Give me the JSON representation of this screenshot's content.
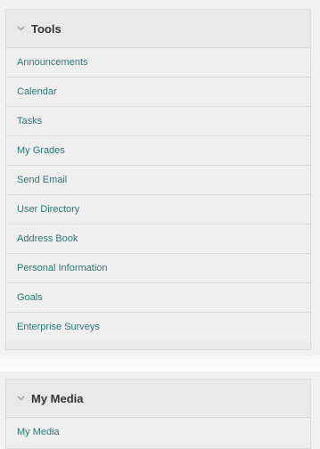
{
  "tools": {
    "title": "Tools",
    "items": [
      {
        "label": "Announcements"
      },
      {
        "label": "Calendar"
      },
      {
        "label": "Tasks"
      },
      {
        "label": "My Grades"
      },
      {
        "label": "Send Email"
      },
      {
        "label": "User Directory"
      },
      {
        "label": "Address Book"
      },
      {
        "label": "Personal Information"
      },
      {
        "label": "Goals"
      },
      {
        "label": "Enterprise Surveys"
      }
    ]
  },
  "media": {
    "title": "My Media",
    "items": [
      {
        "label": "My Media"
      }
    ]
  },
  "colors": {
    "link": "#2a7a73",
    "header_text": "#333333",
    "panel_bg": "#ebebeb"
  },
  "icons": {
    "collapse": "chevron-down-icon"
  }
}
